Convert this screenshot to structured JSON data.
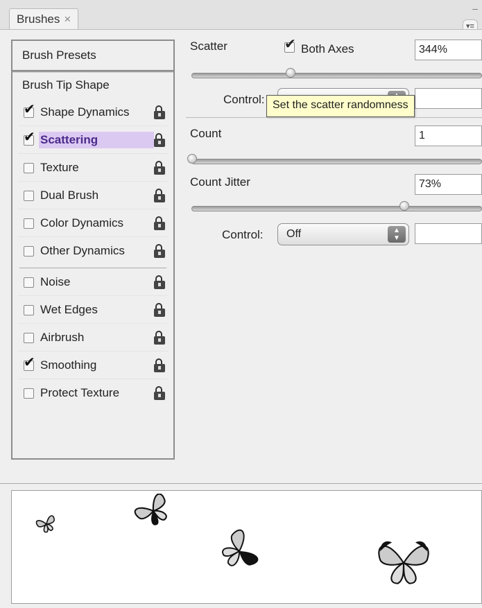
{
  "panel": {
    "tab_label": "Brushes",
    "tab_close": "×",
    "menu_icon": "panel-menu-icon"
  },
  "sidebar": {
    "brush_presets": "Brush Presets",
    "brush_tip_shape": "Brush Tip Shape",
    "options": [
      {
        "label": "Shape Dynamics",
        "checked": true
      },
      {
        "label": "Scattering",
        "checked": true,
        "selected": true
      },
      {
        "label": "Texture",
        "checked": false
      },
      {
        "label": "Dual Brush",
        "checked": false
      },
      {
        "label": "Color Dynamics",
        "checked": false
      },
      {
        "label": "Other Dynamics",
        "checked": false
      },
      {
        "label": "Noise",
        "checked": false
      },
      {
        "label": "Wet Edges",
        "checked": false
      },
      {
        "label": "Airbrush",
        "checked": false
      },
      {
        "label": "Smoothing",
        "checked": true
      },
      {
        "label": "Protect Texture",
        "checked": false
      }
    ]
  },
  "scattering": {
    "scatter_label": "Scatter",
    "both_axes_label": "Both Axes",
    "both_axes_checked": true,
    "scatter_value": "344%",
    "scatter_slider_fraction": 0.344,
    "control_label": "Control:",
    "scatter_control_value": "",
    "tooltip": "Set the scatter randomness",
    "count_label": "Count",
    "count_value": "1",
    "count_slider_fraction": 0.0,
    "count_jitter_label": "Count Jitter",
    "count_jitter_value": "73%",
    "count_jitter_slider_fraction": 0.73,
    "count_jitter_control_value": "Off"
  },
  "colors": {
    "selection_bg": "#dcc9f2",
    "tooltip_bg": "#fffecb"
  }
}
